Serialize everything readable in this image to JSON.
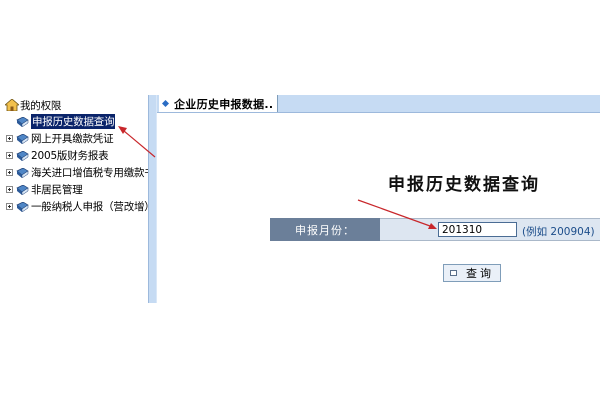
{
  "sidebar": {
    "root_label": "我的权限",
    "items": [
      {
        "label": "申报历史数据查询",
        "selected": true,
        "expandable": false
      },
      {
        "label": "网上开具缴款凭证",
        "selected": false,
        "expandable": true
      },
      {
        "label": "2005版财务报表",
        "selected": false,
        "expandable": true
      },
      {
        "label": "海关进口增值税专用缴款书",
        "selected": false,
        "expandable": true
      },
      {
        "label": "非居民管理",
        "selected": false,
        "expandable": true
      },
      {
        "label": "一般纳税人申报（营改增）",
        "selected": false,
        "expandable": true
      }
    ]
  },
  "tab": {
    "label": "企业历史申报数据.."
  },
  "main": {
    "title": "申报历史数据查询",
    "form": {
      "field_label": "申报月份：",
      "month_value": "201310",
      "example_hint": "(例如 200904)"
    },
    "query_button_label": "查询"
  },
  "colors": {
    "accent_blue": "#c6dbf3",
    "label_cell": "#6b7f99",
    "selected_bg": "#0a246a",
    "arrow_red": "#c8272b"
  }
}
